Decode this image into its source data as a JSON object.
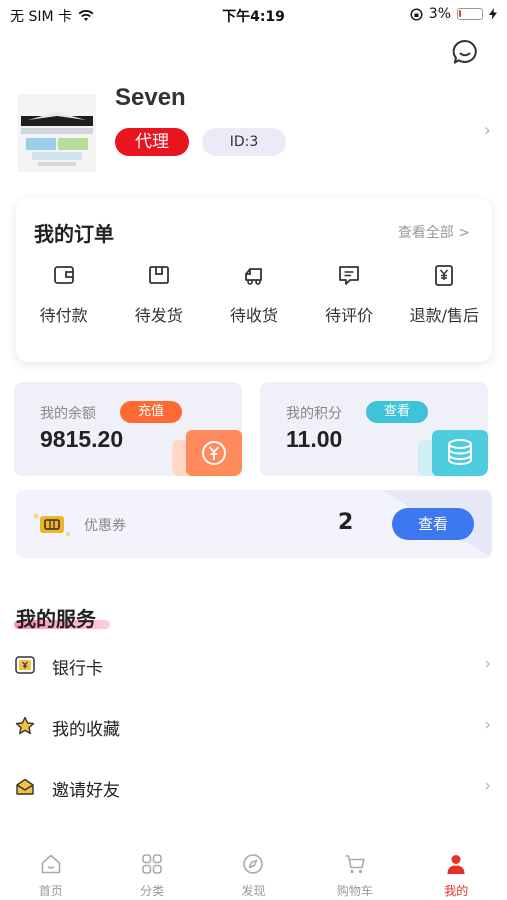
{
  "status_bar": {
    "carrier": "无 SIM 卡",
    "time": "下午4:19",
    "battery_percent_label": "3%",
    "battery_level": 0.03
  },
  "profile": {
    "name": "Seven",
    "role_tag": "代理",
    "id_tag": "ID:3"
  },
  "orders": {
    "title": "我的订单",
    "view_all": "查看全部 >",
    "items": [
      {
        "label": "待付款",
        "icon": "wallet-icon"
      },
      {
        "label": "待发货",
        "icon": "box-icon"
      },
      {
        "label": "待收货",
        "icon": "truck-icon"
      },
      {
        "label": "待评价",
        "icon": "comment-icon"
      },
      {
        "label": "退款/售后",
        "icon": "refund-icon"
      }
    ]
  },
  "balance": {
    "label": "我的余额",
    "value": "9815.20",
    "action": "充值",
    "color": "#ff6a33"
  },
  "points": {
    "label": "我的积分",
    "value": "11.00",
    "action": "查看",
    "color": "#3fc3d9"
  },
  "coupon": {
    "label": "优惠券",
    "count": "2",
    "action": "查看",
    "color": "#3d78f0"
  },
  "services": {
    "title": "我的服务",
    "items": [
      {
        "label": "银行卡",
        "icon": "bank-card-icon"
      },
      {
        "label": "我的收藏",
        "icon": "star-icon"
      },
      {
        "label": "邀请好友",
        "icon": "envelope-icon"
      }
    ]
  },
  "tabbar": {
    "items": [
      {
        "label": "首页",
        "icon": "home-icon"
      },
      {
        "label": "分类",
        "icon": "grid-icon"
      },
      {
        "label": "发现",
        "icon": "compass-icon"
      },
      {
        "label": "购物车",
        "icon": "cart-icon"
      },
      {
        "label": "我的",
        "icon": "user-icon",
        "active": true
      }
    ],
    "active_color": "#e8302a"
  }
}
